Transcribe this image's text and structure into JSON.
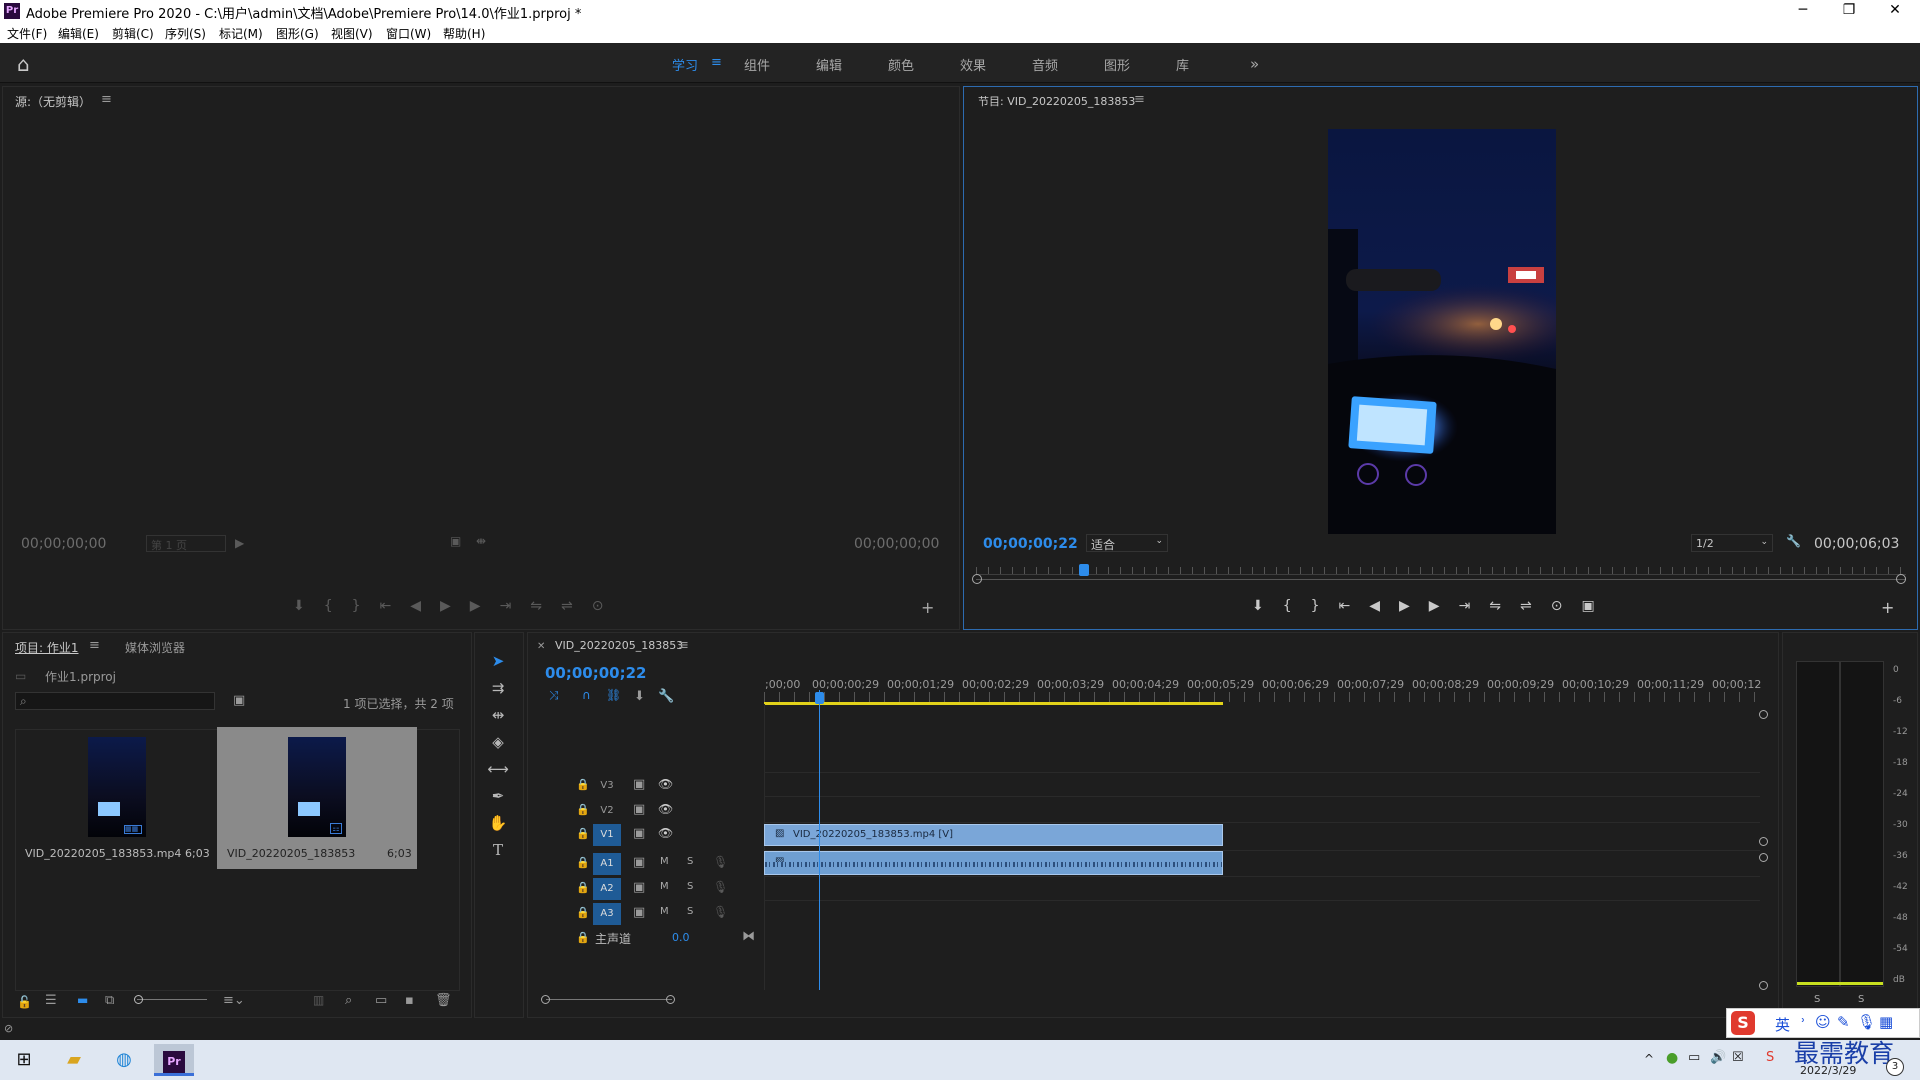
{
  "window": {
    "title": "Adobe Premiere Pro 2020 - C:\\用户\\admin\\文档\\Adobe\\Premiere Pro\\14.0\\作业1.prproj *",
    "logo": "Pr"
  },
  "menu": [
    "文件(F)",
    "编辑(E)",
    "剪辑(C)",
    "序列(S)",
    "标记(M)",
    "图形(G)",
    "视图(V)",
    "窗口(W)",
    "帮助(H)"
  ],
  "workspaces": [
    "学习",
    "组件",
    "编辑",
    "颜色",
    "效果",
    "音频",
    "图形",
    "库"
  ],
  "source": {
    "title": "源:（无剪辑）",
    "tc_left": "00;00;00;00",
    "page": "第 1 页",
    "tc_right": "00;00;00;00"
  },
  "program": {
    "title": "节目: VID_20220205_183853",
    "tc_left": "00;00;00;22",
    "fit": "适合",
    "res": "1/2",
    "tc_right": "00;00;06;03",
    "playhead_fraction": 0.116
  },
  "project": {
    "tabs": [
      "项目: 作业1",
      "媒体浏览器"
    ],
    "file": "作业1.prproj",
    "search_placeholder": "",
    "count": "1 项已选择，共 2 项",
    "items": [
      {
        "name": "VID_20220205_183853.mp4",
        "dur": "6;03"
      },
      {
        "name": "VID_20220205_183853",
        "dur": "6;03"
      }
    ]
  },
  "timeline": {
    "seq": "VID_20220205_183853",
    "tc": "00;00;00;22",
    "ruler": [
      ";00;00",
      "00;00;00;29",
      "00;00;01;29",
      "00;00;02;29",
      "00;00;03;29",
      "00;00;04;29",
      "00;00;05;29",
      "00;00;06;29",
      "00;00;07;29",
      "00;00;08;29",
      "00;00;09;29",
      "00;00;10;29",
      "00;00;11;29",
      "00;00;12"
    ],
    "video_tracks": [
      "V3",
      "V2",
      "V1"
    ],
    "audio_tracks": [
      "A1",
      "A2",
      "A3"
    ],
    "master": "主声道",
    "master_val": "0.0",
    "clip_v": "VID_20220205_183853.mp4 [V]",
    "m": "M",
    "s": "S"
  },
  "meter": {
    "scale": [
      "0",
      "-6",
      "-12",
      "-18",
      "-24",
      "-30",
      "-36",
      "-42",
      "-48",
      "-54",
      "dB"
    ],
    "solo": [
      "S",
      "S"
    ]
  },
  "taskbar": {
    "ime": "英",
    "date": "2022/3/29",
    "watermark": "最需教育",
    "badge": "3"
  },
  "colors": {
    "accent": "#2d8ceb",
    "clip_video": "#7aa6d8",
    "clip_audio": "#6f9fd2",
    "playhead": "#2d8ceb",
    "workarea": "#e2d21a"
  }
}
